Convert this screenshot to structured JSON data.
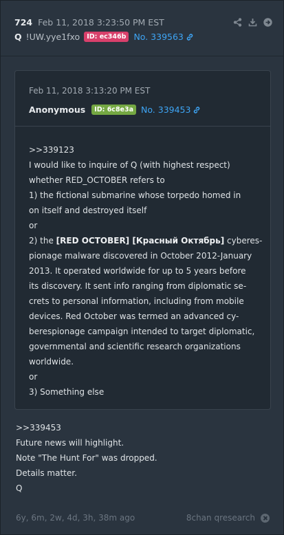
{
  "post": {
    "number": "724",
    "timestamp": "Feb 11, 2018 3:23:50 PM EST",
    "author": "Q",
    "tripcode": "!UW.yye1fxo",
    "id_badge": "ID: ec346b",
    "link": "No. 339563",
    "body_lines": [
      ">>339453",
      "Future news will highlight.",
      "Note \"The Hunt For\" was dropped.",
      "Details matter.",
      "Q"
    ]
  },
  "actions": [
    "share-icon",
    "download-icon",
    "forward-icon"
  ],
  "quoted": {
    "timestamp": "Feb 11, 2018 3:13:20 PM EST",
    "author": "Anonymous",
    "id_badge": "ID: 6c8e3a",
    "link": "No. 339453",
    "lines": [
      {
        "text": ">>339123"
      },
      {
        "text": "I would like to inquire of Q (with highest respect)"
      },
      {
        "text": "whether RED_OCTOBER refers to"
      },
      {
        "text": "1) the fictional submarine whose torpedo homed in"
      },
      {
        "text": "on itself and destroyed itself"
      },
      {
        "text": "or"
      },
      {
        "pre": "2) the ",
        "bold": "[RED OCTOBER] [Красный Октябрь]",
        "post": " cyberes-"
      },
      {
        "text": "pionage malware discovered in October 2012-January"
      },
      {
        "text": "2013. It operated worldwide for up to 5 years before"
      },
      {
        "text": "its discovery. It sent info ranging from diplomatic se-"
      },
      {
        "text": "crets to personal information, including from mobile"
      },
      {
        "text": "devices. Red October was termed an advanced cy-"
      },
      {
        "text": "berespionage campaign intended to target diplomatic,"
      },
      {
        "text": "governmental and scientific research organizations"
      },
      {
        "text": "worldwide."
      },
      {
        "text": "or"
      },
      {
        "text": "3) Something else"
      }
    ]
  },
  "footer": {
    "age": "6y, 6m, 2w, 4d, 3h, 38m ago",
    "source": "8chan qresearch"
  },
  "colors": {
    "background": "#27313c",
    "id_badge_q": "#d9406b",
    "id_badge_anon": "#75a843",
    "link": "#3ea5f5"
  }
}
